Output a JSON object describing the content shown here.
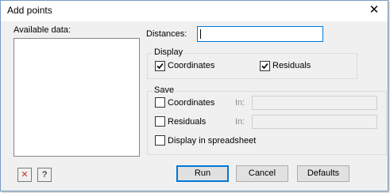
{
  "window": {
    "title": "Add points",
    "close_symbol": "✕"
  },
  "available_data": {
    "label": "Available data:"
  },
  "distances": {
    "label": "Distances:",
    "value": ""
  },
  "display": {
    "legend": "Display",
    "coordinates": {
      "label": "Coordinates",
      "checked": true
    },
    "residuals": {
      "label": "Residuals",
      "checked": true
    }
  },
  "save": {
    "legend": "Save",
    "coordinates": {
      "label": "Coordinates",
      "checked": false,
      "in_label": "In:",
      "value": ""
    },
    "residuals": {
      "label": "Residuals",
      "checked": false,
      "in_label": "In:",
      "value": ""
    },
    "spreadsheet": {
      "label": "Display in spreadsheet",
      "checked": false
    }
  },
  "footer": {
    "clear_symbol": "✕",
    "help_symbol": "?",
    "run_label": "Run",
    "cancel_label": "Cancel",
    "defaults_label": "Defaults"
  },
  "colors": {
    "accent": "#0078d7",
    "clear_icon": "#c0392b"
  }
}
